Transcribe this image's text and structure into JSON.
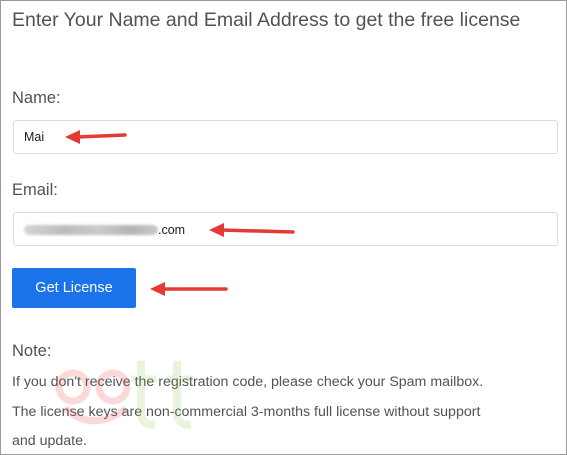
{
  "form": {
    "heading": "Enter Your Name and Email Address to get the free license",
    "name_label": "Name:",
    "name_value": "Mai",
    "email_label": "Email:",
    "email_suffix": ".com",
    "submit_label": "Get License"
  },
  "note": {
    "title": "Note:",
    "lines": [
      "If you don't receive the registration code, please check your Spam mailbox.",
      "The license keys are non-commercial 3-months full license without support",
      "and update."
    ]
  },
  "colors": {
    "accent": "#1a73e8",
    "annotation_arrow": "#e53935"
  }
}
